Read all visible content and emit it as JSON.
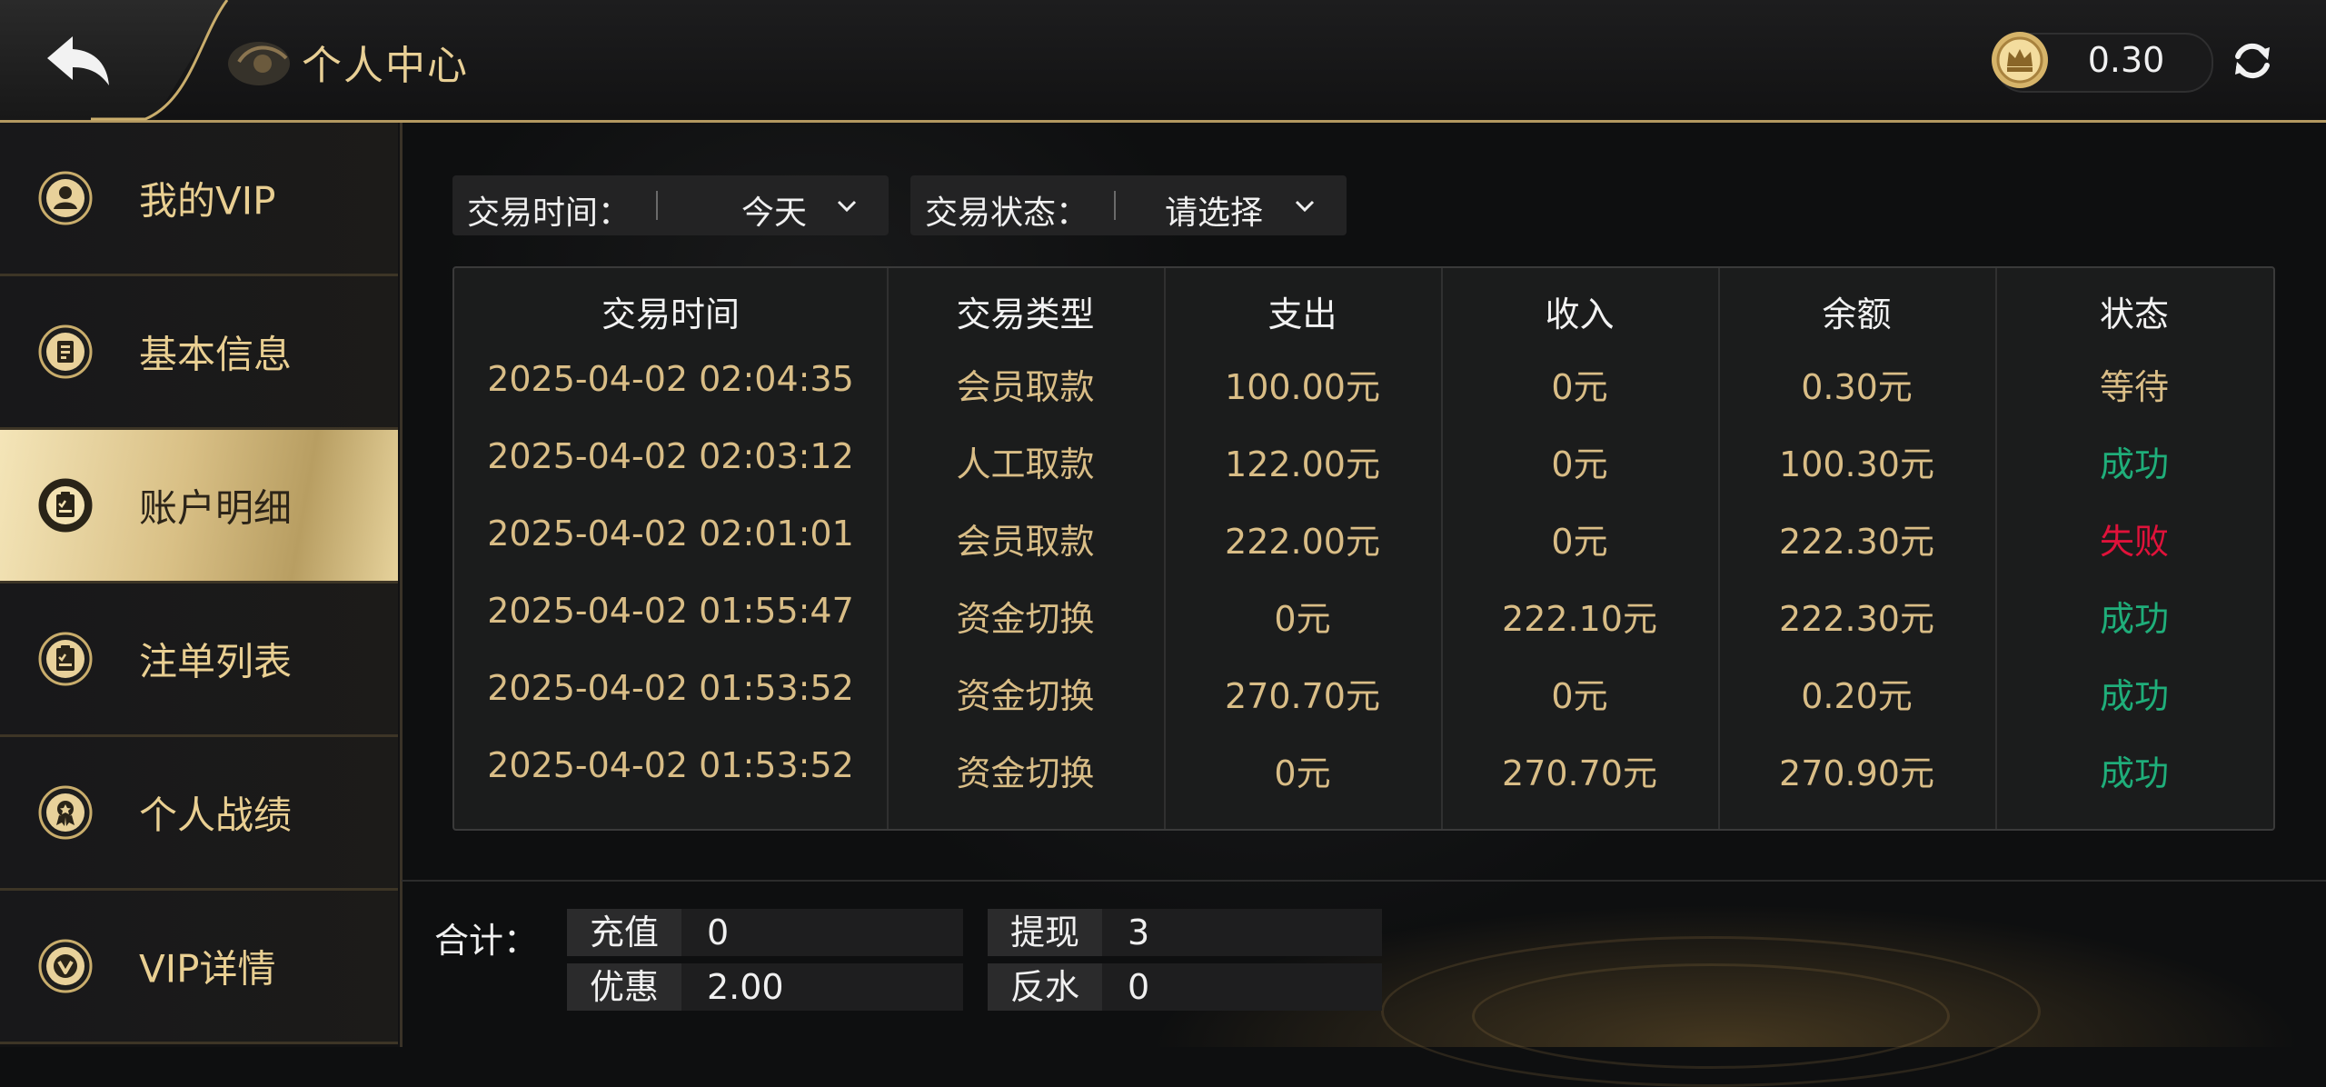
{
  "header": {
    "title": "个人中心",
    "balance": "0.30",
    "back_icon": "back-arrow-icon",
    "refresh_icon": "refresh-icon",
    "coin_icon": "crown-coin-icon"
  },
  "sidebar": {
    "items": [
      {
        "label": "我的VIP",
        "icon": "user-icon",
        "active": false
      },
      {
        "label": "基本信息",
        "icon": "id-card-icon",
        "active": false
      },
      {
        "label": "账户明细",
        "icon": "clipboard-icon",
        "active": true
      },
      {
        "label": "注单列表",
        "icon": "clipboard-list-icon",
        "active": false
      },
      {
        "label": "个人战绩",
        "icon": "medal-icon",
        "active": false
      },
      {
        "label": "VIP详情",
        "icon": "vip-badge-icon",
        "active": false
      }
    ]
  },
  "filters": {
    "time_label": "交易时间：",
    "time_value": "今天",
    "status_label": "交易状态：",
    "status_value": "请选择"
  },
  "table": {
    "headers": [
      "交易时间",
      "交易类型",
      "支出",
      "收入",
      "余额",
      "状态"
    ],
    "rows": [
      [
        "2025-04-02 02:04:35",
        "会员取款",
        "100.00元",
        "0元",
        "0.30元",
        "等待"
      ],
      [
        "2025-04-02 02:03:12",
        "人工取款",
        "122.00元",
        "0元",
        "100.30元",
        "成功"
      ],
      [
        "2025-04-02 02:01:01",
        "会员取款",
        "222.00元",
        "0元",
        "222.30元",
        "失败"
      ],
      [
        "2025-04-02 01:55:47",
        "资金切换",
        "0元",
        "222.10元",
        "222.30元",
        "成功"
      ],
      [
        "2025-04-02 01:53:52",
        "资金切换",
        "270.70元",
        "0元",
        "0.20元",
        "成功"
      ],
      [
        "2025-04-02 01:53:52",
        "资金切换",
        "0元",
        "270.70元",
        "270.90元",
        "成功"
      ]
    ]
  },
  "summary": {
    "title": "合计：",
    "recharge_label": "充值",
    "recharge_value": "0",
    "withdraw_label": "提现",
    "withdraw_value": "3",
    "discount_label": "优惠",
    "discount_value": "2.00",
    "rebate_label": "反水",
    "rebate_value": "0"
  },
  "colors": {
    "gold": "#e6c98f",
    "success": "#1fae7a",
    "fail": "#e0123a",
    "pending": "#d9bd86"
  }
}
